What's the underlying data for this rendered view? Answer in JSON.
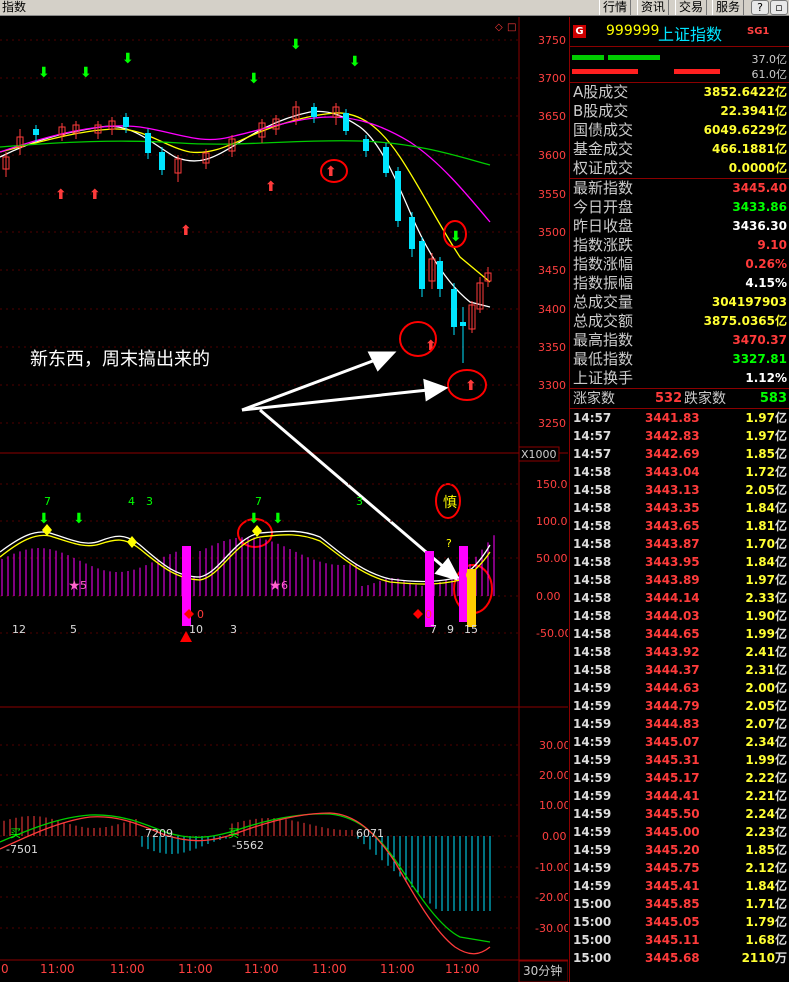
{
  "window": {
    "title": "指数",
    "menu": [
      "行情",
      "资讯",
      "交易",
      "服务"
    ],
    "btn_help": "?",
    "btn_restore": "▫"
  },
  "chart": {
    "annotation": "新东西，周末搞出来的",
    "price_axis": [
      "3750",
      "3700",
      "3650",
      "3600",
      "3550",
      "3500",
      "3450",
      "3400",
      "3350",
      "3300",
      "3250"
    ],
    "scale_label": "X1000",
    "ind1_axis": [
      "150.0",
      "100.0",
      "50.00",
      "0.00",
      "-50.00"
    ],
    "ind2_axis": [
      "30.00",
      "20.00",
      "10.00",
      "0.00",
      "-10.00",
      "-20.00",
      "-30.00"
    ],
    "time_labels": [
      "0",
      "11:00",
      "11:00",
      "11:00",
      "11:00",
      "11:00",
      "11:00",
      "11:00"
    ],
    "period_label": "30分钟",
    "ind1_labels": [
      "7",
      "4",
      "3",
      "7",
      "3",
      "12",
      "5",
      "10",
      "3",
      "7",
      "9",
      "15",
      "0",
      "0",
      "5",
      "6",
      "?"
    ],
    "shen_label": "慎",
    "ind2_labels": [
      "-7501",
      "7209",
      "-5562",
      "6071",
      "买",
      "买"
    ],
    "colors": {
      "up": "#ff3b3b",
      "down": "#00e5ff",
      "ma_white": "#ffffff",
      "ma_yellow": "#ffff00",
      "ma_magenta": "#ff00ff",
      "ma_green": "#00cc00",
      "grid": "#8b0000"
    }
  },
  "quote": {
    "badge": "G",
    "code": "999999",
    "name": "上证指数",
    "sg": "SG1",
    "ratio_up": "37.0亿",
    "ratio_down": "61.0亿",
    "stats": [
      {
        "label": "A股成交",
        "value": "3852.6422亿",
        "color": "#ffff33"
      },
      {
        "label": "B股成交",
        "value": "22.3941亿",
        "color": "#ffff33"
      },
      {
        "label": "国债成交",
        "value": "6049.6229亿",
        "color": "#ffff33"
      },
      {
        "label": "基金成交",
        "value": "466.1881亿",
        "color": "#ffff33"
      },
      {
        "label": "权证成交",
        "value": "0.0000亿",
        "color": "#ffff33"
      }
    ],
    "stats2": [
      {
        "label": "最新指数",
        "value": "3445.40",
        "color": "#ff3b3b"
      },
      {
        "label": "今日开盘",
        "value": "3433.86",
        "color": "#00ff00"
      },
      {
        "label": "昨日收盘",
        "value": "3436.30",
        "color": "#ffffff"
      },
      {
        "label": "指数涨跌",
        "value": "9.10",
        "color": "#ff3b3b"
      },
      {
        "label": "指数涨幅",
        "value": "0.26%",
        "color": "#ff3b3b"
      },
      {
        "label": "指数振幅",
        "value": "4.15%",
        "color": "#ffffff"
      },
      {
        "label": "总成交量",
        "value": "304197903",
        "color": "#ffff33"
      },
      {
        "label": "总成交额",
        "value": "3875.0365亿",
        "color": "#ffff33"
      },
      {
        "label": "最高指数",
        "value": "3470.37",
        "color": "#ff3b3b"
      },
      {
        "label": "最低指数",
        "value": "3327.81",
        "color": "#00ff00"
      },
      {
        "label": "上证换手",
        "value": "1.12%",
        "color": "#ffffff"
      }
    ],
    "up_label": "涨家数",
    "up_count": "532",
    "down_label": "跌家数",
    "down_count": "583",
    "ticks": [
      {
        "t": "14:57",
        "p": "3441.83",
        "v": "1.97",
        "u": "亿"
      },
      {
        "t": "14:57",
        "p": "3442.83",
        "v": "1.97",
        "u": "亿"
      },
      {
        "t": "14:57",
        "p": "3442.69",
        "v": "1.85",
        "u": "亿"
      },
      {
        "t": "14:58",
        "p": "3443.04",
        "v": "1.72",
        "u": "亿"
      },
      {
        "t": "14:58",
        "p": "3443.13",
        "v": "2.05",
        "u": "亿"
      },
      {
        "t": "14:58",
        "p": "3443.35",
        "v": "1.84",
        "u": "亿"
      },
      {
        "t": "14:58",
        "p": "3443.65",
        "v": "1.81",
        "u": "亿"
      },
      {
        "t": "14:58",
        "p": "3443.87",
        "v": "1.70",
        "u": "亿"
      },
      {
        "t": "14:58",
        "p": "3443.95",
        "v": "1.84",
        "u": "亿"
      },
      {
        "t": "14:58",
        "p": "3443.89",
        "v": "1.97",
        "u": "亿"
      },
      {
        "t": "14:58",
        "p": "3444.14",
        "v": "2.33",
        "u": "亿"
      },
      {
        "t": "14:58",
        "p": "3444.03",
        "v": "1.90",
        "u": "亿"
      },
      {
        "t": "14:58",
        "p": "3444.65",
        "v": "1.99",
        "u": "亿"
      },
      {
        "t": "14:58",
        "p": "3443.92",
        "v": "2.41",
        "u": "亿"
      },
      {
        "t": "14:58",
        "p": "3444.37",
        "v": "2.31",
        "u": "亿"
      },
      {
        "t": "14:59",
        "p": "3444.63",
        "v": "2.00",
        "u": "亿"
      },
      {
        "t": "14:59",
        "p": "3444.79",
        "v": "2.05",
        "u": "亿"
      },
      {
        "t": "14:59",
        "p": "3444.83",
        "v": "2.07",
        "u": "亿"
      },
      {
        "t": "14:59",
        "p": "3445.07",
        "v": "2.34",
        "u": "亿"
      },
      {
        "t": "14:59",
        "p": "3445.31",
        "v": "1.99",
        "u": "亿"
      },
      {
        "t": "14:59",
        "p": "3445.17",
        "v": "2.22",
        "u": "亿"
      },
      {
        "t": "14:59",
        "p": "3444.41",
        "v": "2.21",
        "u": "亿"
      },
      {
        "t": "14:59",
        "p": "3445.50",
        "v": "2.24",
        "u": "亿"
      },
      {
        "t": "14:59",
        "p": "3445.00",
        "v": "2.23",
        "u": "亿"
      },
      {
        "t": "14:59",
        "p": "3445.20",
        "v": "1.85",
        "u": "亿"
      },
      {
        "t": "14:59",
        "p": "3445.75",
        "v": "2.12",
        "u": "亿"
      },
      {
        "t": "14:59",
        "p": "3445.41",
        "v": "1.84",
        "u": "亿"
      },
      {
        "t": "15:00",
        "p": "3445.85",
        "v": "1.71",
        "u": "亿"
      },
      {
        "t": "15:00",
        "p": "3445.05",
        "v": "1.79",
        "u": "亿"
      },
      {
        "t": "15:00",
        "p": "3445.11",
        "v": "1.68",
        "u": "亿"
      },
      {
        "t": "15:00",
        "p": "3445.68",
        "v": "2110",
        "u": "万"
      }
    ]
  }
}
